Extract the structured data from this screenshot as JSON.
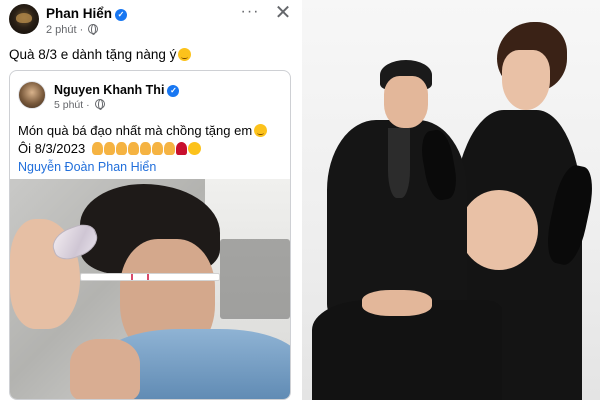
{
  "post": {
    "author": "Phan Hiển",
    "time": "2 phút",
    "caption": "Quà 8/3 e dành tặng nàng ý",
    "more_label": "···",
    "close_label": "✕",
    "shared": {
      "author": "Nguyen Khanh Thi",
      "time": "5 phút",
      "line1": "Món quà bá đạo nhất mà chồng tặng em",
      "line2": "Ôi 8/3/2023",
      "tag": "Nguyễn Đoàn Phan Hiển"
    }
  },
  "icons": {
    "verified": "verified-badge-icon",
    "globe": "globe-icon",
    "more": "more-options-icon",
    "close": "close-icon",
    "emoji": "grinning-face-icon",
    "pray": "folded-hands-icon"
  },
  "colors": {
    "link": "#216fdb",
    "verified": "#1877f2",
    "meta_text": "#65676b",
    "card_border": "#ced0d4"
  }
}
